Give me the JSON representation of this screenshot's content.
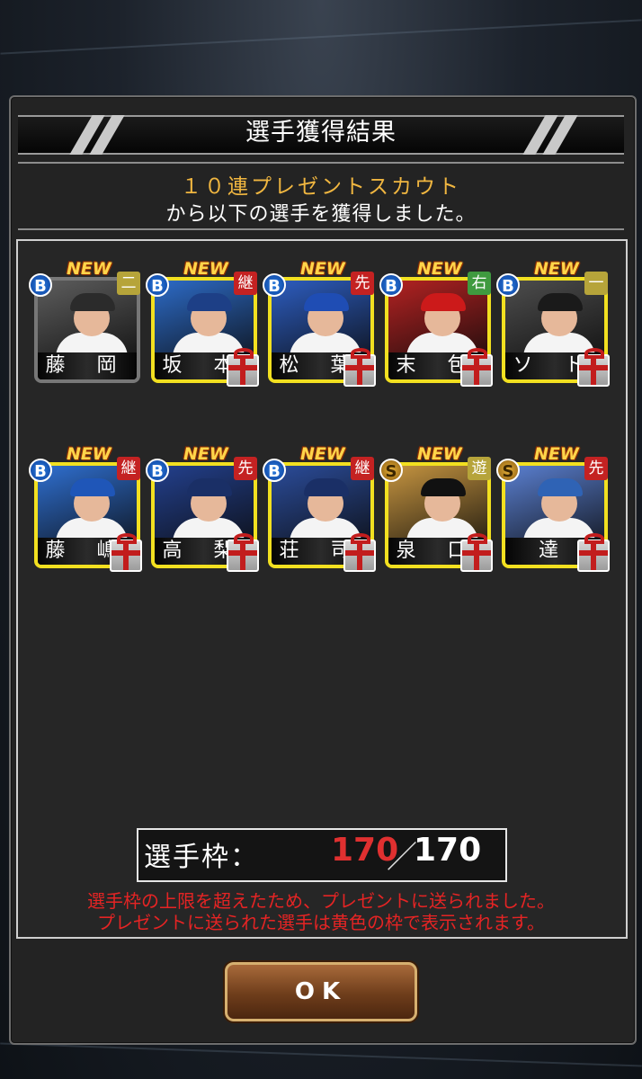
{
  "dialog": {
    "title": "選手獲得結果",
    "subtitle": "１０連プレゼントスカウト",
    "description": "から以下の選手を獲得しました。"
  },
  "players": [
    {
      "name": "藤 岡",
      "rank": "B",
      "position": "二",
      "new_label": "NEW",
      "gift": false,
      "pos_color": "#b6a43a",
      "photo": "#5d5d5d",
      "cap": "#2b2b2b"
    },
    {
      "name": "坂 本",
      "rank": "B",
      "position": "継",
      "new_label": "NEW",
      "gift": true,
      "pos_color": "#c42222",
      "photo": "#2d6bc7",
      "cap": "#1d3f86"
    },
    {
      "name": "松 葉",
      "rank": "B",
      "position": "先",
      "new_label": "NEW",
      "gift": true,
      "pos_color": "#c42222",
      "photo": "#2d5dc0",
      "cap": "#1f4db4"
    },
    {
      "name": "末 包",
      "rank": "B",
      "position": "右",
      "new_label": "NEW",
      "gift": true,
      "pos_color": "#3f9a3f",
      "photo": "#b32222",
      "cap": "#cc1a1a"
    },
    {
      "name": "ソ ト",
      "rank": "B",
      "position": "一",
      "new_label": "NEW",
      "gift": true,
      "pos_color": "#b6a43a",
      "photo": "#4d4d4d",
      "cap": "#1a1a1a"
    },
    {
      "name": "藤 嶋",
      "rank": "B",
      "position": "継",
      "new_label": "NEW",
      "gift": true,
      "pos_color": "#c42222",
      "photo": "#2f6fd0",
      "cap": "#1f56b8"
    },
    {
      "name": "高 梨",
      "rank": "B",
      "position": "先",
      "new_label": "NEW",
      "gift": true,
      "pos_color": "#c42222",
      "photo": "#23408d",
      "cap": "#1a2f66"
    },
    {
      "name": "荘 司",
      "rank": "B",
      "position": "継",
      "new_label": "NEW",
      "gift": true,
      "pos_color": "#c42222",
      "photo": "#2b4c9a",
      "cap": "#1a2f66"
    },
    {
      "name": "泉 口",
      "rank": "S",
      "position": "遊",
      "new_label": "NEW",
      "gift": true,
      "pos_color": "#b6a43a",
      "photo": "#c59440",
      "cap": "#111111"
    },
    {
      "name": "達",
      "rank": "S",
      "position": "先",
      "new_label": "NEW",
      "gift": true,
      "pos_color": "#c42222",
      "photo": "#5a7fd0",
      "cap": "#2f63b5"
    }
  ],
  "roster": {
    "label": "選手枠：",
    "current": "170",
    "separator": "／",
    "max": "170",
    "current_color": "#e03030"
  },
  "warnings": [
    "選手枠の上限を超えたため、プレゼントに送られました。",
    "プレゼントに送られた選手は黄色の枠で表示されます。"
  ],
  "ok_button": "OK",
  "colors": {
    "gift_frame": "#f2e020",
    "warning": "#e52424",
    "subtitle": "#f0b640"
  }
}
